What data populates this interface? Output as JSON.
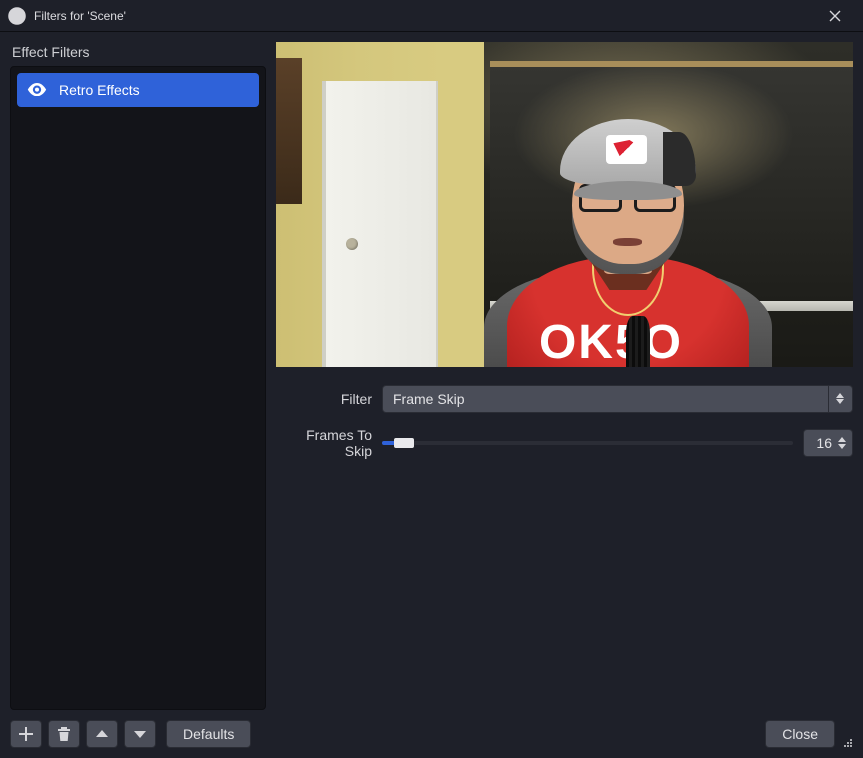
{
  "window": {
    "title": "Filters for 'Scene'"
  },
  "sidebar": {
    "header": "Effect Filters",
    "items": [
      {
        "label": "Retro Effects",
        "visible": true,
        "selected": true
      }
    ]
  },
  "properties": {
    "filter_label": "Filter",
    "filter_value": "Frame Skip",
    "frames_label": "Frames To Skip",
    "frames_value": "16",
    "frames_min": 0,
    "frames_max": 300,
    "frames_current": 16
  },
  "buttons": {
    "defaults": "Defaults",
    "close": "Close"
  },
  "preview": {
    "shirt_text": "OK5O"
  }
}
